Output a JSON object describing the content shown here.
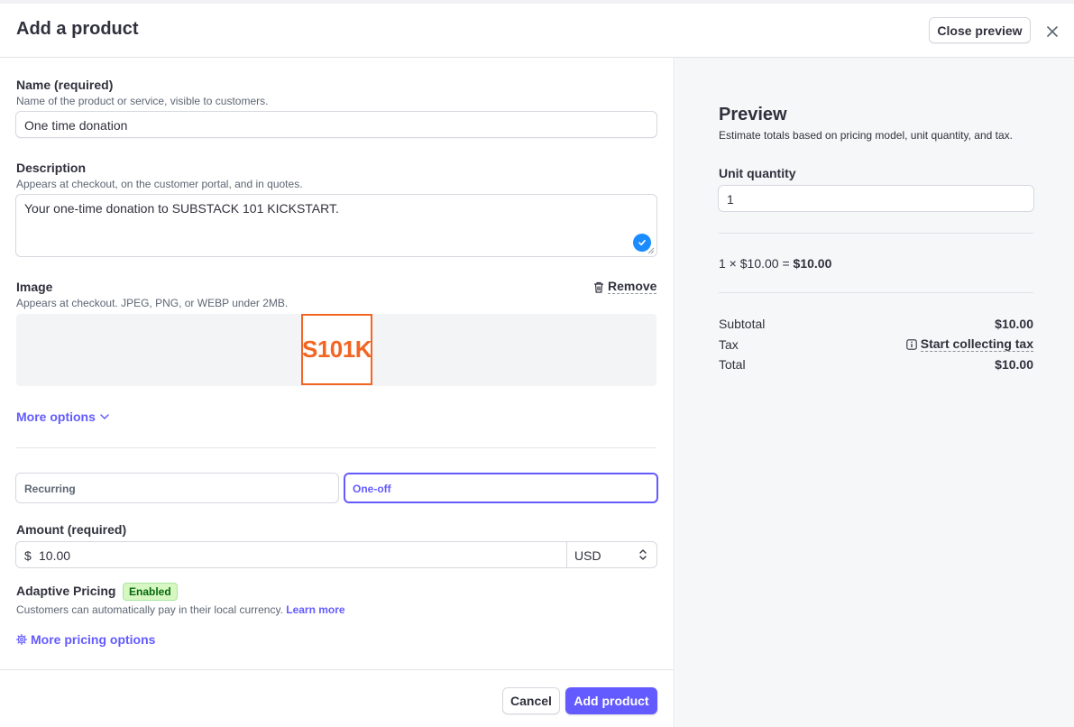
{
  "header": {
    "title": "Add a product",
    "close_preview": "Close preview"
  },
  "form": {
    "name": {
      "label": "Name (required)",
      "help": "Name of the product or service, visible to customers.",
      "value": "One time donation"
    },
    "description": {
      "label": "Description",
      "help": "Appears at checkout, on the customer portal, and in quotes.",
      "value": "Your one-time donation to SUBSTACK 101 KICKSTART."
    },
    "image": {
      "label": "Image",
      "help": "Appears at checkout. JPEG, PNG, or WEBP under 2MB.",
      "remove": "Remove",
      "logo_text": "S101K"
    },
    "more_options": "More options",
    "pricing_type": {
      "recurring": "Recurring",
      "one_off": "One-off",
      "selected": "One-off"
    },
    "amount": {
      "label": "Amount (required)",
      "currency_symbol": "$",
      "value": "10.00",
      "currency": "USD"
    },
    "adaptive": {
      "label": "Adaptive Pricing",
      "badge": "Enabled",
      "help": "Customers can automatically pay in their local currency.",
      "learn_more": "Learn more"
    },
    "more_pricing": "More pricing options"
  },
  "footer": {
    "cancel": "Cancel",
    "add": "Add product"
  },
  "preview": {
    "title": "Preview",
    "subtitle": "Estimate totals based on pricing model, unit quantity, and tax.",
    "unit_quantity_label": "Unit quantity",
    "unit_quantity": "1",
    "calc_prefix": "1 × $10.00 = ",
    "calc_total": "$10.00",
    "subtotal_label": "Subtotal",
    "subtotal": "$10.00",
    "tax_label": "Tax",
    "tax_link": "Start collecting tax",
    "total_label": "Total",
    "total": "$10.00"
  },
  "colors": {
    "accent": "#635bff",
    "logo": "#f26522",
    "badge_bg": "#d7f7c2",
    "badge_text": "#05690d"
  }
}
